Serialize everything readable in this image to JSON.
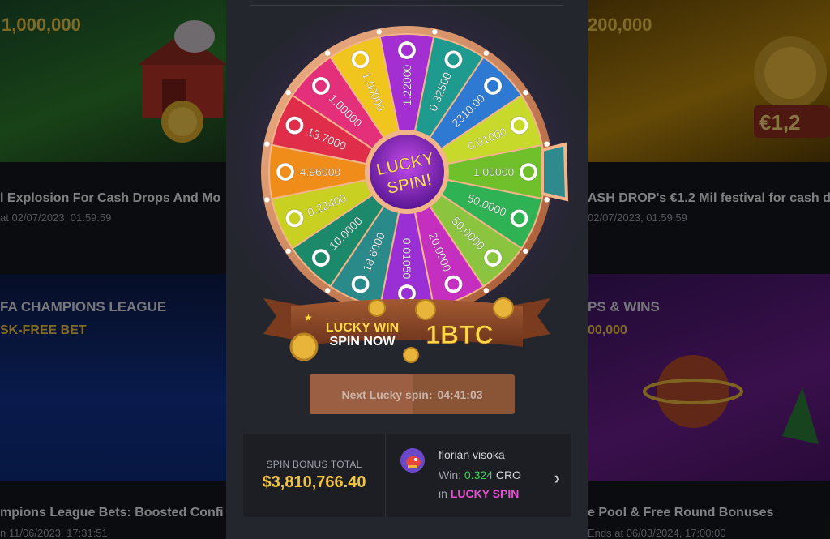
{
  "background": {
    "cards": [
      {
        "amount": "1,000,000",
        "title": "l Explosion For Cash Drops And Mo",
        "date": "at 02/07/2023, 01:59:59"
      },
      {
        "amount": "200,000",
        "title": "ASH DROP's €1.2 Mil festival for cash d",
        "date": "02/07/2023, 01:59:59"
      },
      {
        "kicker": "FA CHAMPIONS LEAGUE",
        "kicker2": "SK-FREE BET",
        "title": "mpions League Bets: Boosted Confi",
        "date": "n 11/06/2023, 17:31:51"
      },
      {
        "kicker": "PS & WINS",
        "kicker2": "00,000",
        "title": "e Pool & Free Round Bonuses",
        "date": "Ends at 06/03/2024, 17:00:00"
      }
    ]
  },
  "wheel": {
    "center_line1": "LUCKY",
    "center_line2": "SPIN!",
    "segments": [
      {
        "value": "1.00000",
        "color": "#6fc02b",
        "coin": "bitcoin"
      },
      {
        "value": "50.0000",
        "color": "#2fb254",
        "coin": "usdc"
      },
      {
        "value": "50.0000",
        "color": "#8bc53f",
        "coin": "polygon"
      },
      {
        "value": "20.0000",
        "color": "#c42fbf",
        "coin": "tether"
      },
      {
        "value": "0.01050",
        "color": "#9b2fd6",
        "coin": "ethereum"
      },
      {
        "value": "18.6000",
        "color": "#2a8a8a",
        "coin": "xrp"
      },
      {
        "value": "10.0000",
        "color": "#1c8a6a",
        "coin": "polygon"
      },
      {
        "value": "0.22400",
        "color": "#c8d022",
        "coin": "solana"
      },
      {
        "value": "4.96000",
        "color": "#f08c1a",
        "coin": "lockx"
      },
      {
        "value": "13.7000",
        "color": "#e02d4a",
        "coin": "polygon"
      },
      {
        "value": "1.00000",
        "color": "#e42f7a",
        "coin": "polygon"
      },
      {
        "value": "1.00000",
        "color": "#f0c51e",
        "coin": "polygon"
      },
      {
        "value": "1.22000",
        "color": "#a32fd2",
        "coin": "tron"
      },
      {
        "value": "0.32500",
        "color": "#1f9a8e",
        "coin": "cronos"
      },
      {
        "value": "2310.00",
        "color": "#2e7ad2",
        "coin": "shiba"
      },
      {
        "value": "0.01000",
        "color": "#c7d92a",
        "coin": "polygon"
      }
    ]
  },
  "banner": {
    "line1": "LUCKY WIN",
    "line2": "SPIN NOW",
    "prize": "1BTC"
  },
  "next_spin": {
    "label": "Next Lucky spin:",
    "time": "04:41:03",
    "progress": 0.5
  },
  "spin_bonus": {
    "label": "SPIN BONUS TOTAL",
    "value": "$3,810,766.40"
  },
  "last_winner": {
    "name": "florian visoka",
    "win_prefix": "Win:",
    "win_amount": "0.324",
    "win_currency": "CRO",
    "in_prefix": "in",
    "game": "LUCKY SPIN"
  },
  "colors": {
    "modal_bg": "#23262d",
    "accent_gold": "#f3c33e",
    "win_green": "#3fd25b",
    "game_pink": "#e64fd1",
    "button_bg": "#8a5437"
  }
}
